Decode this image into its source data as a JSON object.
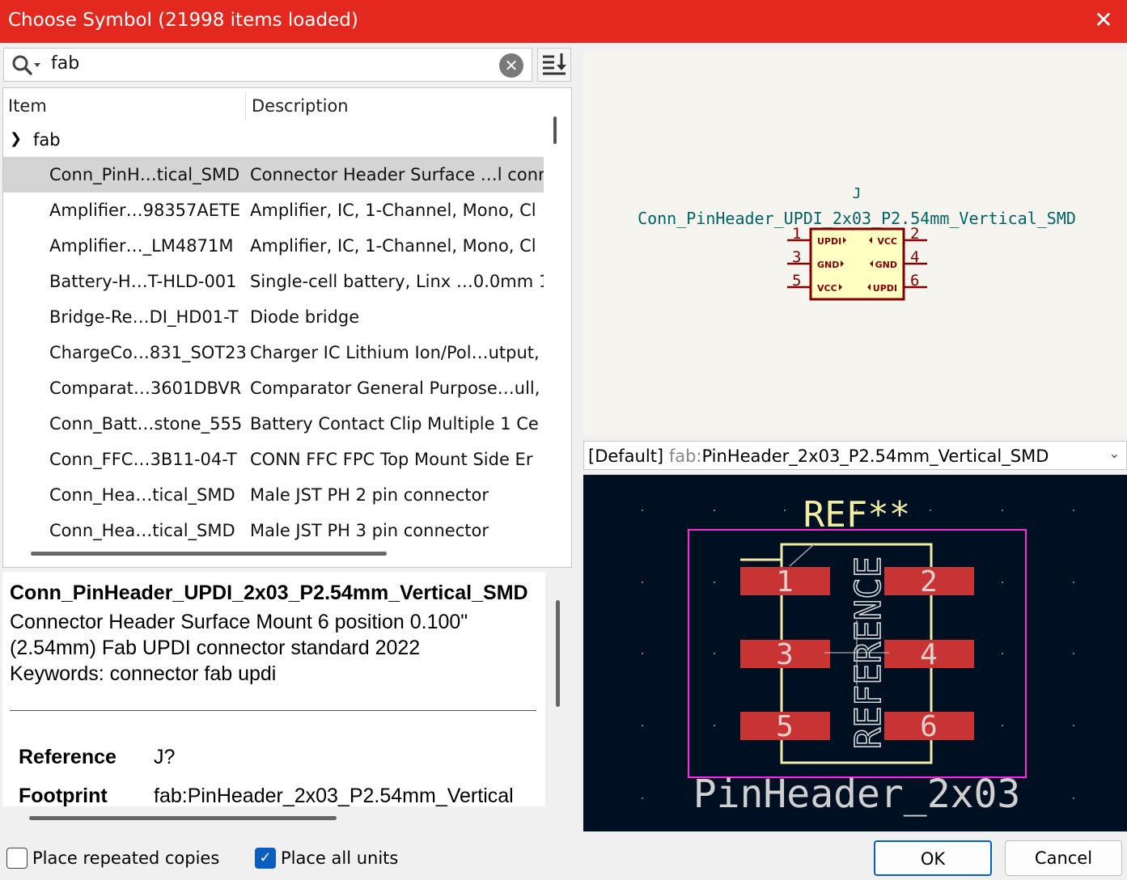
{
  "window": {
    "title": "Choose Symbol (21998 items loaded)"
  },
  "search": {
    "query": "fab"
  },
  "tree": {
    "columns": {
      "item": "Item",
      "description": "Description"
    },
    "group": "fab",
    "rows": [
      {
        "item": "Conn_PinH…tical_SMD",
        "desc": "Connector Header Surface …l conn",
        "selected": true
      },
      {
        "item": "Amplifier…98357AETE",
        "desc": "Amplifier, IC, 1-Channel, Mono, Cl"
      },
      {
        "item": "Amplifier…_LM4871M",
        "desc": "Amplifier, IC, 1-Channel, Mono, Cl"
      },
      {
        "item": "Battery-H…T-HLD-001",
        "desc": "Single-cell battery, Linx …0.0mm 1"
      },
      {
        "item": "Bridge-Re…DI_HD01-T",
        "desc": "Diode bridge"
      },
      {
        "item": "ChargeCo…831_SOT23",
        "desc": "Charger IC Lithium Ion/Pol…utput,"
      },
      {
        "item": "Comparat…3601DBVR",
        "desc": "Comparator General Purpose…ull,"
      },
      {
        "item": "Conn_Batt…stone_555",
        "desc": "Battery Contact Clip Multiple 1 Ce"
      },
      {
        "item": "Conn_FFC…3B11-04-T",
        "desc": "CONN FFC FPC Top Mount Side Er"
      },
      {
        "item": "Conn_Hea…tical_SMD",
        "desc": "Male JST PH 2 pin connector"
      },
      {
        "item": "Conn_Hea…tical_SMD",
        "desc": "Male JST PH 3 pin connector"
      }
    ]
  },
  "details": {
    "name": "Conn_PinHeader_UPDI_2x03_P2.54mm_Vertical_SMD",
    "description": "Connector Header Surface Mount 6 position 0.100\" (2.54mm) Fab UPDI connector standard 2022",
    "keywords": "Keywords: connector fab updi",
    "reference_label": "Reference",
    "reference_value": "J?",
    "footprint_label": "Footprint",
    "footprint_value": "fab:PinHeader_2x03_P2.54mm_Vertical"
  },
  "symbol": {
    "ref": "J",
    "value": "Conn_PinHeader_UPDI_2x03_P2.54mm_Vertical_SMD",
    "pins": [
      {
        "num": "1",
        "name": "UPDI"
      },
      {
        "num": "2",
        "name": "VCC"
      },
      {
        "num": "3",
        "name": "GND"
      },
      {
        "num": "4",
        "name": "GND"
      },
      {
        "num": "5",
        "name": "VCC"
      },
      {
        "num": "6",
        "name": "UPDI"
      }
    ]
  },
  "footprint_select": {
    "prefix": "[Default]",
    "lib": "fab:",
    "name": "PinHeader_2x03_P2.54mm_Vertical_SMD"
  },
  "footprint_preview": {
    "ref": "REF**",
    "reference": "REFERENCE",
    "value": "PinHeader_2x03",
    "pads": [
      "1",
      "2",
      "3",
      "4",
      "5",
      "6"
    ]
  },
  "footer": {
    "repeat_label": "Place repeated copies",
    "repeat_checked": false,
    "allunits_label": "Place all units",
    "allunits_checked": true,
    "ok": "OK",
    "cancel": "Cancel"
  },
  "colors": {
    "titlebar": "#e3291f",
    "schematic_line": "#840000",
    "schematic_body": "#ffffc2",
    "symbol_text": "#006464",
    "pcb_bg": "#001023",
    "pad": "#c83434",
    "silk": "#f2eda1",
    "courtyard": "#ff26e2"
  }
}
